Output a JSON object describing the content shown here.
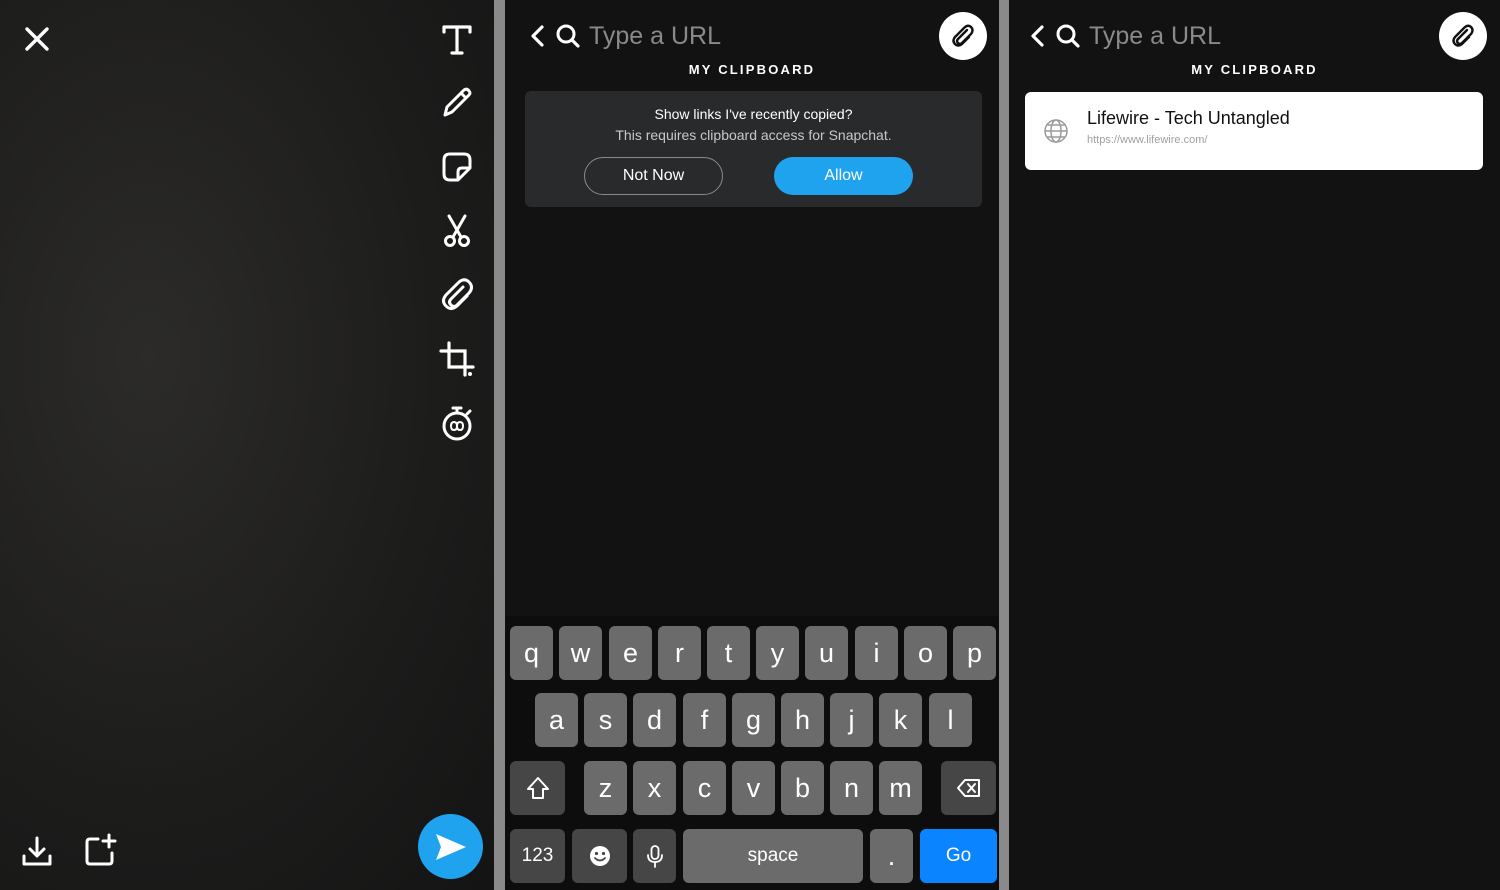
{
  "editor": {
    "tools": [
      "text-tool",
      "pen-tool",
      "sticker-tool",
      "scissors-tool",
      "paperclip-tool",
      "crop-tool",
      "timer-tool"
    ]
  },
  "attach": {
    "search_placeholder": "Type a URL",
    "section_title": "MY CLIPBOARD",
    "permission": {
      "question": "Show links I've recently copied?",
      "subtext": "This requires clipboard access for Snapchat.",
      "not_now": "Not Now",
      "allow": "Allow"
    },
    "keyboard": {
      "row1": [
        "q",
        "w",
        "e",
        "r",
        "t",
        "y",
        "u",
        "i",
        "o",
        "p"
      ],
      "row2": [
        "a",
        "s",
        "d",
        "f",
        "g",
        "h",
        "j",
        "k",
        "l"
      ],
      "row3": [
        "z",
        "x",
        "c",
        "v",
        "b",
        "n",
        "m"
      ],
      "numbers": "123",
      "space": "space",
      "period": ".",
      "go": "Go"
    }
  },
  "clipboard": {
    "search_placeholder": "Type a URL",
    "section_title": "MY CLIPBOARD",
    "item": {
      "title": "Lifewire - Tech Untangled",
      "url": "https://www.lifewire.com/"
    }
  },
  "colors": {
    "accent_blue": "#1fa3ef",
    "keyboard_go": "#0a84ff"
  }
}
